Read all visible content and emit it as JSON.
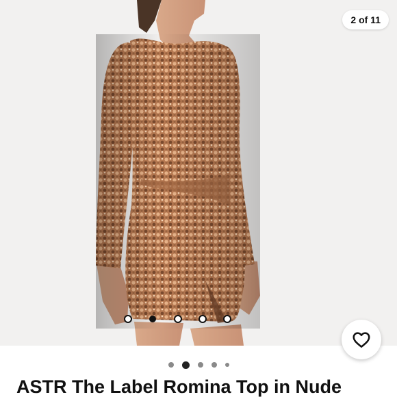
{
  "gallery": {
    "counter": "2 of 11",
    "current_index": 2,
    "total": 11
  },
  "like_button": {
    "icon": "heart-outline-icon"
  },
  "pager": {
    "dots": 5,
    "active": 1
  },
  "product": {
    "title": "ASTR The Label Romina Top in Nude"
  },
  "colors": {
    "sequin": "#c58a5f",
    "background": "#f2f1f0",
    "text": "#111111"
  }
}
